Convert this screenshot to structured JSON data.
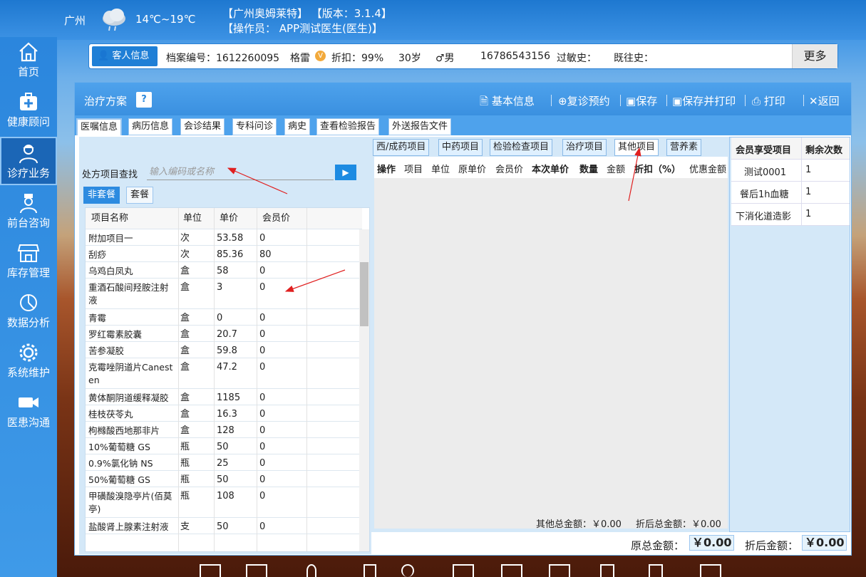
{
  "header": {
    "city": "广州",
    "temperature": "14℃~19℃",
    "title_line1": "【广州奥姆莱特】 【版本：3.1.4】",
    "title_line2": "【操作员： APP测试医生(医生)】"
  },
  "sidebar": {
    "items": [
      {
        "label": "首页",
        "icon": "home-icon"
      },
      {
        "label": "健康顾问",
        "icon": "medkit-icon"
      },
      {
        "label": "诊疗业务",
        "icon": "doctor-icon",
        "active": true
      },
      {
        "label": "前台咨询",
        "icon": "nurse-icon"
      },
      {
        "label": "库存管理",
        "icon": "store-icon"
      },
      {
        "label": "数据分析",
        "icon": "pie-chart-icon"
      },
      {
        "label": "系统维护",
        "icon": "gear-icon"
      },
      {
        "label": "医患沟通",
        "icon": "video-camera-icon"
      }
    ]
  },
  "patient": {
    "tag": "客人信息",
    "file_no": "档案编号：1612260095",
    "name": "格雷",
    "vip_badge": "V",
    "discount": "折扣：99%",
    "age": "30岁",
    "gender": "♂男",
    "phone": "16786543156",
    "allergy": "过敏史：",
    "history": "既往史：",
    "more": "更多"
  },
  "panel": {
    "title": "治疗方案",
    "help": "?",
    "actions": {
      "basic_info": "基本信息",
      "followup": "复诊预约",
      "save": "保存",
      "save_print": "保存并打印",
      "print": "打印",
      "back": "返回"
    },
    "tabs": [
      "医嘱信息",
      "病历信息",
      "会诊结果",
      "专科问诊",
      "病史",
      "查看检验报告",
      "外送报告文件"
    ]
  },
  "left": {
    "search_label": "处方项目查找",
    "search_placeholder": "输入编码或名称",
    "subtabs": [
      "非套餐",
      "套餐"
    ],
    "columns": [
      "项目名称",
      "单位",
      "单价",
      "会员价"
    ],
    "rows": [
      [
        "附加项目一",
        "次",
        "53.58",
        "0"
      ],
      [
        "刮痧",
        "次",
        "85.36",
        "80"
      ],
      [
        "乌鸡白凤丸",
        "盒",
        "58",
        "0"
      ],
      [
        "重酒石酸间羟胺注射液",
        "盒",
        "3",
        "0"
      ],
      [
        "青霉",
        "盒",
        "0",
        "0"
      ],
      [
        "罗红霉素胶囊",
        "盒",
        "20.7",
        "0"
      ],
      [
        "苦参凝胶",
        "盒",
        "59.8",
        "0"
      ],
      [
        "克霉唑阴道片Canesten",
        "盒",
        "47.2",
        "0"
      ],
      [
        "黄体酮阴道缓释凝胶",
        "盒",
        "1185",
        "0"
      ],
      [
        "桂枝茯苓丸",
        "盒",
        "16.3",
        "0"
      ],
      [
        "枸橼酸西地那非片",
        "盒",
        "128",
        "0"
      ],
      [
        "10%葡萄糖 GS",
        "瓶",
        "50",
        "0"
      ],
      [
        "0.9%氯化钠 NS",
        "瓶",
        "25",
        "0"
      ],
      [
        "50%葡萄糖 GS",
        "瓶",
        "50",
        "0"
      ],
      [
        "甲磺酸溴隐亭片(佰莫亭)",
        "瓶",
        "108",
        "0"
      ],
      [
        "盐酸肾上腺素注射液",
        "支",
        "50",
        "0"
      ]
    ]
  },
  "center": {
    "tabs": [
      "西/成药项目",
      "中药项目",
      "检验检查项目",
      "治疗项目",
      "其他项目",
      "营养素"
    ],
    "columns": [
      "操作",
      "项目",
      "单位",
      "原单价",
      "会员价",
      "本次单价",
      "数量",
      "金额",
      "折扣（%）",
      "优惠金额"
    ],
    "other_total": "其他总金额：￥0.00",
    "discount_total": "折后总金额：￥0.00"
  },
  "right": {
    "columns": [
      "会员享受项目",
      "剩余次数"
    ],
    "rows": [
      [
        "测试0001",
        "1"
      ],
      [
        "餐后1h血糖",
        "1"
      ],
      [
        "下消化道造影",
        "1"
      ]
    ]
  },
  "bottom": {
    "orig_label": "原总金额：",
    "orig_value": "￥0.00",
    "disc_label": "折后金额：",
    "disc_value": "￥0.00"
  },
  "colors": {
    "accent": "#1f7fd6",
    "panel_head": "#4ea2ec",
    "arrow": "#e02020"
  }
}
